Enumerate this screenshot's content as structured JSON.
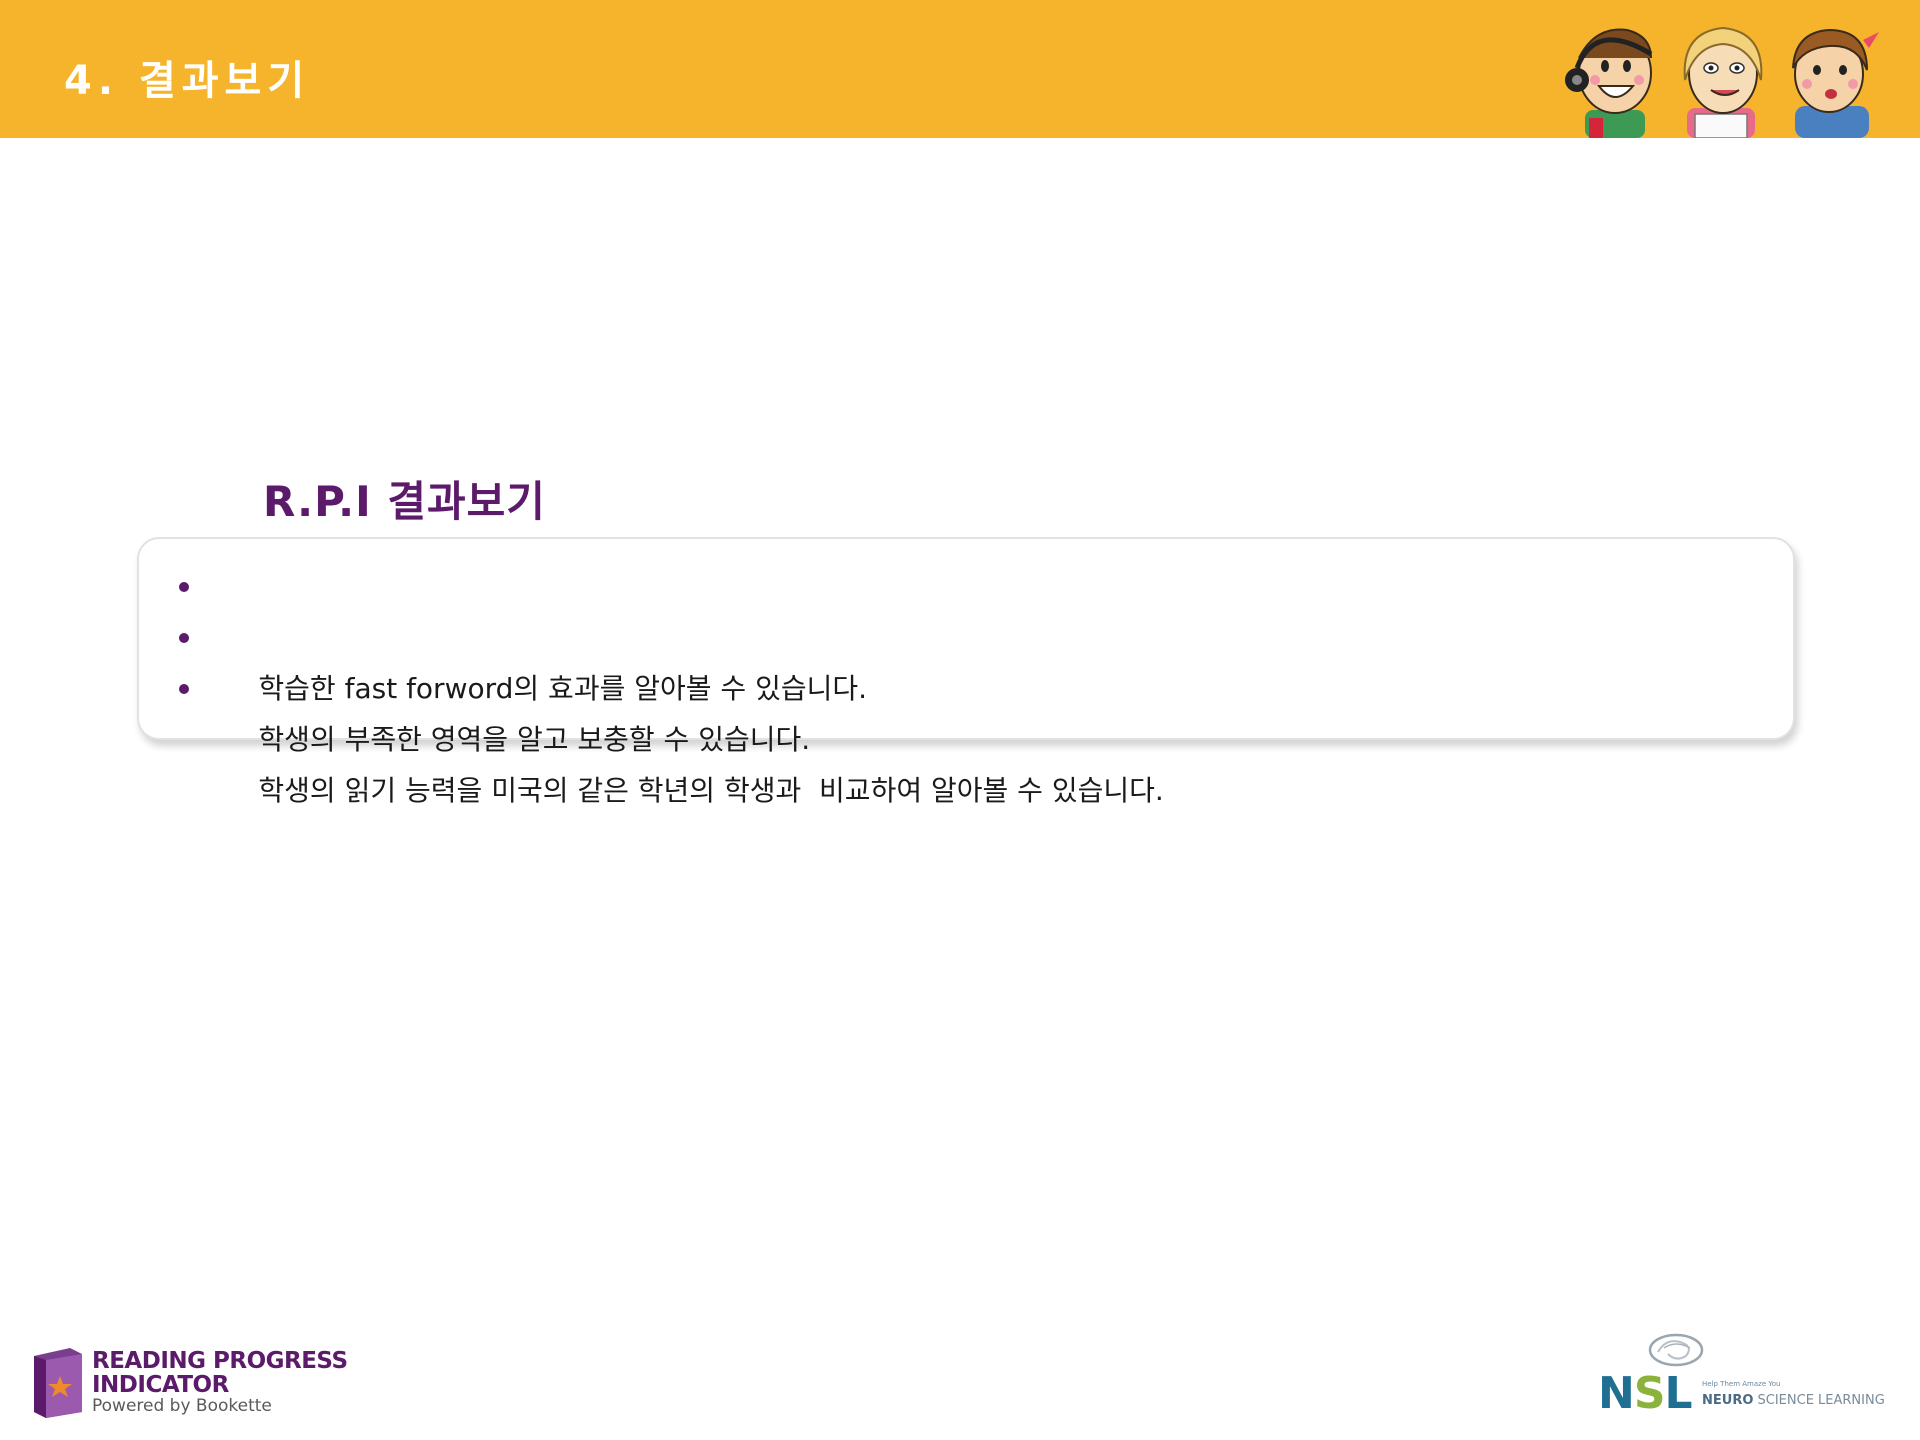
{
  "header": {
    "title": "4. 결과보기",
    "background_color": "#f6b42c"
  },
  "section": {
    "title": "R.P.I  결과보기",
    "title_color": "#5b1a6a"
  },
  "bullets": [
    "학습한 fast forword의 효과를 알아볼 수 있습니다.",
    "학생의 부족한 영역을 알고 보충할 수 있습니다.",
    "학생의 읽기 능력을 미국의 같은 학년의 학생과  비교하여 알아볼 수 있습니다."
  ],
  "footer": {
    "rpi_logo": {
      "line1": "READING PROGRESS",
      "line2": "INDICATOR",
      "line3": "Powered by Bookette",
      "icon": "book-icon"
    },
    "nsl_logo": {
      "letters": [
        "N",
        "S",
        "L"
      ],
      "tagline": "Help Them Amaze You",
      "name_bold": "NEURO",
      "name_rest": " SCIENCE LEARNING",
      "icon": "brain-swirl-icon"
    }
  }
}
